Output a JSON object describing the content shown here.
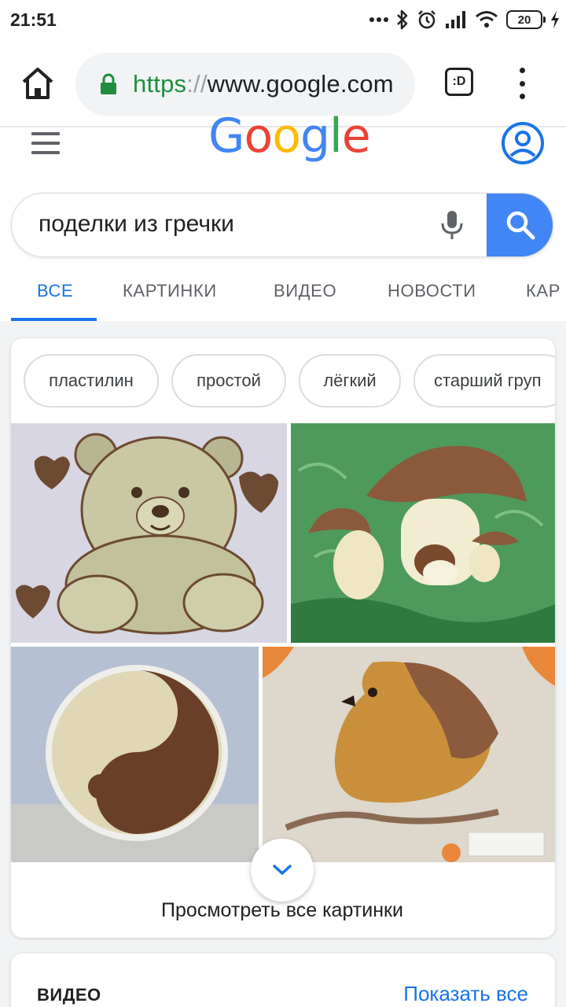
{
  "status_bar": {
    "time": "21:51",
    "battery_level": "20"
  },
  "browser": {
    "url_scheme": "https",
    "url_separator": "://",
    "url_host": "www.google.com",
    "tabs_label": ":D"
  },
  "google": {
    "logo_letters": [
      "G",
      "o",
      "o",
      "g",
      "l",
      "e"
    ],
    "search_query": "поделки из гречки",
    "tabs": [
      "ВСЕ",
      "КАРТИНКИ",
      "ВИДЕО",
      "НОВОСТИ",
      "КАР"
    ],
    "active_tab": "ВСЕ"
  },
  "images_card": {
    "chips": [
      "пластилин",
      "простой",
      "лёгкий",
      "старший груп"
    ],
    "images": [
      "teddy-bear-craft",
      "mushrooms-craft",
      "yin-yang-craft",
      "bird-craft"
    ],
    "view_all_label": "Просмотреть все картинки"
  },
  "video_card": {
    "title": "ВИДЕО",
    "show_all_label": "Показать все"
  },
  "colors": {
    "accent": "#1a73e8",
    "search_button": "#4285f4",
    "secure_green": "#1e8e3e"
  }
}
